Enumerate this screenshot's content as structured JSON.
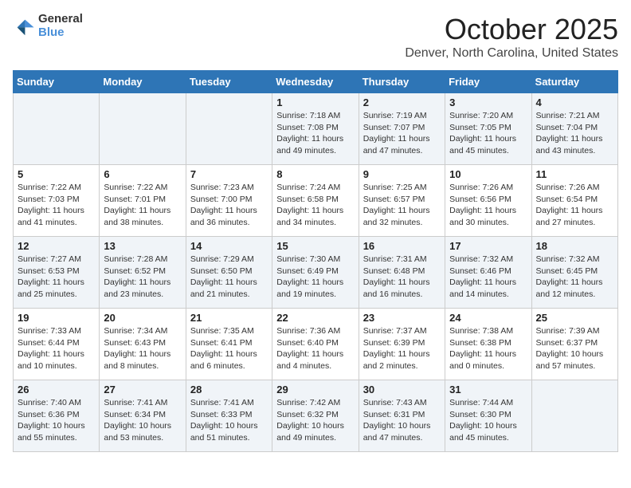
{
  "header": {
    "logo_general": "General",
    "logo_blue": "Blue",
    "month": "October 2025",
    "location": "Denver, North Carolina, United States"
  },
  "days_of_week": [
    "Sunday",
    "Monday",
    "Tuesday",
    "Wednesday",
    "Thursday",
    "Friday",
    "Saturday"
  ],
  "weeks": [
    [
      {
        "day": "",
        "info": ""
      },
      {
        "day": "",
        "info": ""
      },
      {
        "day": "",
        "info": ""
      },
      {
        "day": "1",
        "info": "Sunrise: 7:18 AM\nSunset: 7:08 PM\nDaylight: 11 hours\nand 49 minutes."
      },
      {
        "day": "2",
        "info": "Sunrise: 7:19 AM\nSunset: 7:07 PM\nDaylight: 11 hours\nand 47 minutes."
      },
      {
        "day": "3",
        "info": "Sunrise: 7:20 AM\nSunset: 7:05 PM\nDaylight: 11 hours\nand 45 minutes."
      },
      {
        "day": "4",
        "info": "Sunrise: 7:21 AM\nSunset: 7:04 PM\nDaylight: 11 hours\nand 43 minutes."
      }
    ],
    [
      {
        "day": "5",
        "info": "Sunrise: 7:22 AM\nSunset: 7:03 PM\nDaylight: 11 hours\nand 41 minutes."
      },
      {
        "day": "6",
        "info": "Sunrise: 7:22 AM\nSunset: 7:01 PM\nDaylight: 11 hours\nand 38 minutes."
      },
      {
        "day": "7",
        "info": "Sunrise: 7:23 AM\nSunset: 7:00 PM\nDaylight: 11 hours\nand 36 minutes."
      },
      {
        "day": "8",
        "info": "Sunrise: 7:24 AM\nSunset: 6:58 PM\nDaylight: 11 hours\nand 34 minutes."
      },
      {
        "day": "9",
        "info": "Sunrise: 7:25 AM\nSunset: 6:57 PM\nDaylight: 11 hours\nand 32 minutes."
      },
      {
        "day": "10",
        "info": "Sunrise: 7:26 AM\nSunset: 6:56 PM\nDaylight: 11 hours\nand 30 minutes."
      },
      {
        "day": "11",
        "info": "Sunrise: 7:26 AM\nSunset: 6:54 PM\nDaylight: 11 hours\nand 27 minutes."
      }
    ],
    [
      {
        "day": "12",
        "info": "Sunrise: 7:27 AM\nSunset: 6:53 PM\nDaylight: 11 hours\nand 25 minutes."
      },
      {
        "day": "13",
        "info": "Sunrise: 7:28 AM\nSunset: 6:52 PM\nDaylight: 11 hours\nand 23 minutes."
      },
      {
        "day": "14",
        "info": "Sunrise: 7:29 AM\nSunset: 6:50 PM\nDaylight: 11 hours\nand 21 minutes."
      },
      {
        "day": "15",
        "info": "Sunrise: 7:30 AM\nSunset: 6:49 PM\nDaylight: 11 hours\nand 19 minutes."
      },
      {
        "day": "16",
        "info": "Sunrise: 7:31 AM\nSunset: 6:48 PM\nDaylight: 11 hours\nand 16 minutes."
      },
      {
        "day": "17",
        "info": "Sunrise: 7:32 AM\nSunset: 6:46 PM\nDaylight: 11 hours\nand 14 minutes."
      },
      {
        "day": "18",
        "info": "Sunrise: 7:32 AM\nSunset: 6:45 PM\nDaylight: 11 hours\nand 12 minutes."
      }
    ],
    [
      {
        "day": "19",
        "info": "Sunrise: 7:33 AM\nSunset: 6:44 PM\nDaylight: 11 hours\nand 10 minutes."
      },
      {
        "day": "20",
        "info": "Sunrise: 7:34 AM\nSunset: 6:43 PM\nDaylight: 11 hours\nand 8 minutes."
      },
      {
        "day": "21",
        "info": "Sunrise: 7:35 AM\nSunset: 6:41 PM\nDaylight: 11 hours\nand 6 minutes."
      },
      {
        "day": "22",
        "info": "Sunrise: 7:36 AM\nSunset: 6:40 PM\nDaylight: 11 hours\nand 4 minutes."
      },
      {
        "day": "23",
        "info": "Sunrise: 7:37 AM\nSunset: 6:39 PM\nDaylight: 11 hours\nand 2 minutes."
      },
      {
        "day": "24",
        "info": "Sunrise: 7:38 AM\nSunset: 6:38 PM\nDaylight: 11 hours\nand 0 minutes."
      },
      {
        "day": "25",
        "info": "Sunrise: 7:39 AM\nSunset: 6:37 PM\nDaylight: 10 hours\nand 57 minutes."
      }
    ],
    [
      {
        "day": "26",
        "info": "Sunrise: 7:40 AM\nSunset: 6:36 PM\nDaylight: 10 hours\nand 55 minutes."
      },
      {
        "day": "27",
        "info": "Sunrise: 7:41 AM\nSunset: 6:34 PM\nDaylight: 10 hours\nand 53 minutes."
      },
      {
        "day": "28",
        "info": "Sunrise: 7:41 AM\nSunset: 6:33 PM\nDaylight: 10 hours\nand 51 minutes."
      },
      {
        "day": "29",
        "info": "Sunrise: 7:42 AM\nSunset: 6:32 PM\nDaylight: 10 hours\nand 49 minutes."
      },
      {
        "day": "30",
        "info": "Sunrise: 7:43 AM\nSunset: 6:31 PM\nDaylight: 10 hours\nand 47 minutes."
      },
      {
        "day": "31",
        "info": "Sunrise: 7:44 AM\nSunset: 6:30 PM\nDaylight: 10 hours\nand 45 minutes."
      },
      {
        "day": "",
        "info": ""
      }
    ]
  ]
}
